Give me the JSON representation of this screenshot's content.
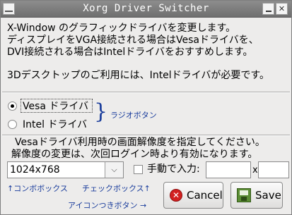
{
  "window": {
    "title": "Xorg Driver Switcher"
  },
  "description": {
    "line1": "X-Window のグラフィックドライバを変更します。",
    "line2": "ディスプレイをVGA接続される場合はVesaドライバを、",
    "line3": "DVI接続される場合はIntelドライバをおすすめします。",
    "line4": "3Dデスクトップのご利用には、Intelドライバが必要です。"
  },
  "drivers": {
    "options": [
      {
        "label": "Vesa ドライバ",
        "selected": true
      },
      {
        "label": "Intel ドライバ",
        "selected": false
      }
    ],
    "annotation": "ラジオボタン"
  },
  "resolution": {
    "info1": "Vesaドライバ利用時の画面解像度を指定してください。",
    "info2": "解像度の変更は、次回ログイン時より有効になります。",
    "selected": "1024x768",
    "manual_label": "手動で入力:",
    "manual_checked": false,
    "x_separator": "x",
    "width_value": "",
    "height_value": ""
  },
  "annotations": {
    "combobox": "↑コンボボックス",
    "checkbox": "チェックボックス↑",
    "icon_button": "アイコンつきボタン →"
  },
  "buttons": {
    "cancel": "Cancel",
    "save": "Save"
  },
  "icons": {
    "cancel": "cancel-icon",
    "save": "save-icon"
  },
  "colors": {
    "annotation": "#1a3d9c",
    "titlebar": "#7d7d7d",
    "cancel_icon": "#d22020",
    "save_icon": "#5b8d34"
  }
}
